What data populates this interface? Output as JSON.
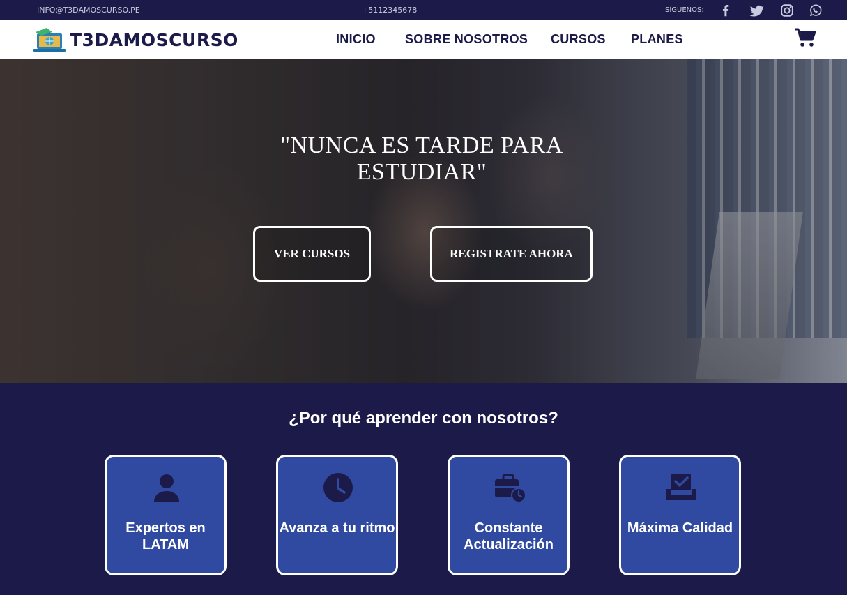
{
  "topbar": {
    "email": "INFO@T3DAMOSCURSO.PE",
    "phone": "+5112345678",
    "follow_label": "SÍGUENOS:",
    "social_icons": [
      "facebook-icon",
      "twitter-icon",
      "instagram-icon",
      "whatsapp-icon"
    ]
  },
  "brand": {
    "name": "T3DAMOSCURSO"
  },
  "nav": {
    "items": [
      {
        "label": "INICIO"
      },
      {
        "label": "SOBRE NOSOTROS"
      },
      {
        "label": "CURSOS"
      },
      {
        "label": "PLANES"
      }
    ],
    "cart_icon": "cart-icon"
  },
  "hero": {
    "title": "\"NUNCA ES TARDE PARA ESTUDIAR\"",
    "buttons": [
      {
        "label": "VER CURSOS"
      },
      {
        "label": "REGISTRATE AHORA"
      }
    ]
  },
  "why": {
    "title": "¿Por qué aprender con nosotros?",
    "cards": [
      {
        "label": "Expertos en LATAM",
        "icon": "user-icon"
      },
      {
        "label": "Avanza a tu ritmo",
        "icon": "clock-icon"
      },
      {
        "label": "Constante Actualización",
        "icon": "briefcase-clock-icon"
      },
      {
        "label": "Máxima Calidad",
        "icon": "inbox-check-icon"
      }
    ]
  },
  "colors": {
    "primary_navy": "#1c1a48",
    "card_blue": "#2f4aa0",
    "white": "#ffffff"
  }
}
